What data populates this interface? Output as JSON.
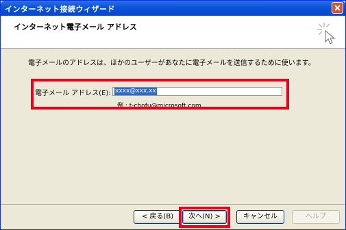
{
  "window": {
    "title": "インターネット接続ウィザード"
  },
  "header": {
    "title": "インターネット電子メール アドレス"
  },
  "body": {
    "description": "電子メールのアドレスは、ほかのユーザーがあなたに電子メールを送信するために使います。",
    "email_label": "電子メール アドレス(E):",
    "email_value": "xxxx@xxx.xx",
    "example": "例 : t-chofu@microsoft.com"
  },
  "buttons": {
    "back": "< 戻る(B)",
    "next": "次へ(N) >",
    "cancel": "キャンセル",
    "help": "ヘルプ"
  },
  "colors": {
    "highlight": "#e8001c",
    "titlebar": "#0a53d8"
  }
}
